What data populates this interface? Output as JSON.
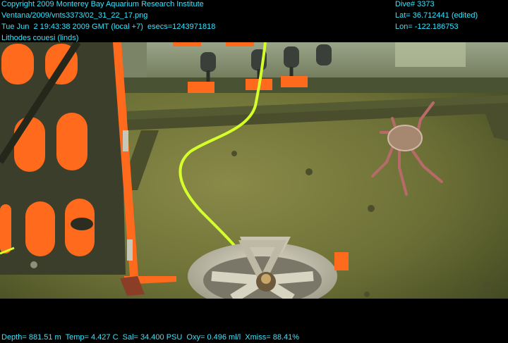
{
  "overlay": {
    "left": [
      "Copyright 2009 Monterey Bay Aquarium Research Institute",
      "Ventana/2009/vnts3373/02_31_22_17.png",
      "Tue Jun  2 19:43:38 2009 GMT (local +7)  esecs=1243971818",
      "Lithodes couesi (linds)"
    ],
    "right": [
      "Dive# 3373",
      "Lat= 36.712441 (edited)",
      "Lon= -122.186753"
    ],
    "bottom": "Depth= 881.51 m  Temp= 4.427 C  Sal= 34.400 PSU  Oxy= 0.496 ml/l  Xmiss= 88.41%"
  },
  "colors": {
    "overlay_text": "#36e6ff",
    "seafloor": "#6f7438",
    "frame_orange": "#ff6a1c",
    "cable": "#d4ff2a",
    "crab": "#b86a6a"
  }
}
